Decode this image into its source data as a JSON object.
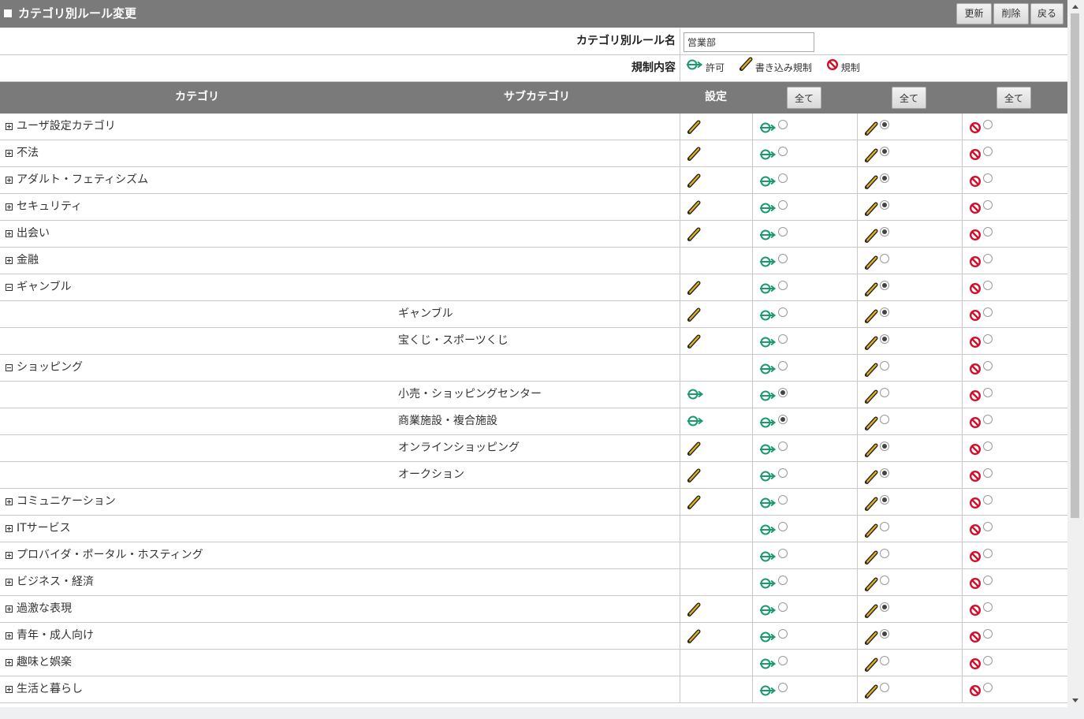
{
  "title": "カテゴリ別ルール変更",
  "buttons": {
    "update": "更新",
    "delete": "削除",
    "back": "戻る",
    "all": "全て"
  },
  "form": {
    "rule_name_label": "カテゴリ別ルール名",
    "rule_name_value": "営業部",
    "restriction_label": "規制内容",
    "legend": {
      "allow": "許可",
      "write_restrict": "書き込み規制",
      "block": "規制"
    }
  },
  "table": {
    "headers": {
      "category": "カテゴリ",
      "subcategory": "サブカテゴリ",
      "setting": "設定"
    },
    "rows": [
      {
        "category": "ユーザ設定カテゴリ",
        "subcategory": "",
        "toggle": "plus",
        "setting": "write",
        "selected": "write"
      },
      {
        "category": "不法",
        "subcategory": "",
        "toggle": "plus",
        "setting": "write",
        "selected": "write"
      },
      {
        "category": "アダルト・フェティシズム",
        "subcategory": "",
        "toggle": "plus",
        "setting": "write",
        "selected": "write"
      },
      {
        "category": "セキュリティ",
        "subcategory": "",
        "toggle": "plus",
        "setting": "write",
        "selected": "write"
      },
      {
        "category": "出会い",
        "subcategory": "",
        "toggle": "plus",
        "setting": "write",
        "selected": "write"
      },
      {
        "category": "金融",
        "subcategory": "",
        "toggle": "plus",
        "setting": "",
        "selected": ""
      },
      {
        "category": "ギャンブル",
        "subcategory": "",
        "toggle": "minus",
        "setting": "write",
        "selected": "write"
      },
      {
        "category": "",
        "subcategory": "ギャンブル",
        "toggle": "",
        "setting": "write",
        "selected": "write"
      },
      {
        "category": "",
        "subcategory": "宝くじ・スポーツくじ",
        "toggle": "",
        "setting": "write",
        "selected": "write"
      },
      {
        "category": "ショッピング",
        "subcategory": "",
        "toggle": "minus",
        "setting": "",
        "selected": ""
      },
      {
        "category": "",
        "subcategory": "小売・ショッピングセンター",
        "toggle": "",
        "setting": "allow",
        "selected": "allow"
      },
      {
        "category": "",
        "subcategory": "商業施設・複合施設",
        "toggle": "",
        "setting": "allow",
        "selected": "allow"
      },
      {
        "category": "",
        "subcategory": "オンラインショッピング",
        "toggle": "",
        "setting": "write",
        "selected": "write"
      },
      {
        "category": "",
        "subcategory": "オークション",
        "toggle": "",
        "setting": "write",
        "selected": "write"
      },
      {
        "category": "コミュニケーション",
        "subcategory": "",
        "toggle": "plus",
        "setting": "write",
        "selected": "write"
      },
      {
        "category": "ITサービス",
        "subcategory": "",
        "toggle": "plus",
        "setting": "",
        "selected": ""
      },
      {
        "category": "プロバイダ・ポータル・ホスティング",
        "subcategory": "",
        "toggle": "plus",
        "setting": "",
        "selected": ""
      },
      {
        "category": "ビジネス・経済",
        "subcategory": "",
        "toggle": "plus",
        "setting": "",
        "selected": ""
      },
      {
        "category": "過激な表現",
        "subcategory": "",
        "toggle": "plus",
        "setting": "write",
        "selected": "write"
      },
      {
        "category": "青年・成人向け",
        "subcategory": "",
        "toggle": "plus",
        "setting": "write",
        "selected": "write"
      },
      {
        "category": "趣味と娯楽",
        "subcategory": "",
        "toggle": "plus",
        "setting": "",
        "selected": ""
      },
      {
        "category": "生活と暮らし",
        "subcategory": "",
        "toggle": "plus",
        "setting": "",
        "selected": ""
      }
    ]
  },
  "colors": {
    "header_bg": "#7a7a7a",
    "allow": "#1a9a6e",
    "write_pencil": "#e2b21a",
    "block": "#d0102a"
  }
}
